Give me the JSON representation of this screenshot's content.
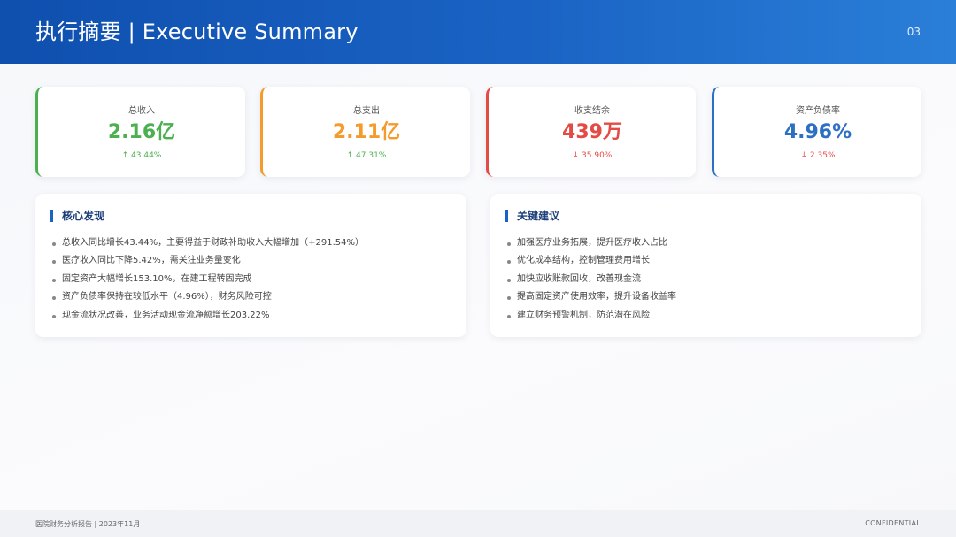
{
  "header": {
    "title": "执行摘要 | Executive Summary",
    "page_number": "03"
  },
  "kpis": [
    {
      "label": "总收入",
      "value": "2.16亿",
      "change": "↑ 43.44%",
      "color": "#4caf50",
      "change_color": "#4caf50"
    },
    {
      "label": "总支出",
      "value": "2.11亿",
      "change": "↑ 47.31%",
      "color": "#f39c2c",
      "change_color": "#4caf50"
    },
    {
      "label": "收支结余",
      "value": "439万",
      "change": "↓ 35.90%",
      "color": "#e44b45",
      "change_color": "#e44b45"
    },
    {
      "label": "资产负债率",
      "value": "4.96%",
      "change": "↓ 2.35%",
      "color": "#2d6fc2",
      "change_color": "#e44b45"
    }
  ],
  "findings": {
    "title": "核心发现",
    "items": [
      "总收入同比增长43.44%，主要得益于财政补助收入大幅增加（+291.54%）",
      "医疗收入同比下降5.42%，需关注业务量变化",
      "固定资产大幅增长153.10%，在建工程转固完成",
      "资产负债率保持在较低水平（4.96%），财务风险可控",
      "现金流状况改善，业务活动现金流净额增长203.22%"
    ]
  },
  "recommendations": {
    "title": "关键建议",
    "items": [
      "加强医疗业务拓展，提升医疗收入占比",
      "优化成本结构，控制管理费用增长",
      "加快应收账款回收，改善现金流",
      "提高固定资产使用效率，提升设备收益率",
      "建立财务预警机制，防范潜在风险"
    ]
  },
  "footer": {
    "left": "医院财务分析报告 | 2023年11月",
    "right": "CONFIDENTIAL"
  }
}
